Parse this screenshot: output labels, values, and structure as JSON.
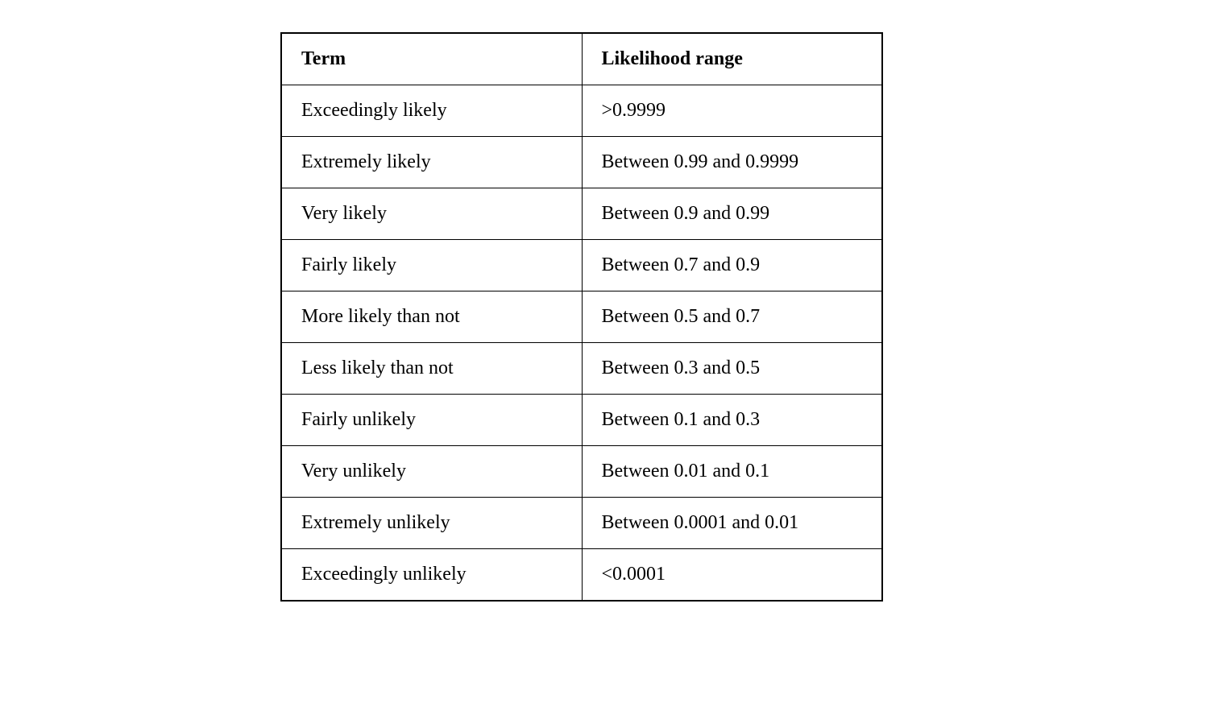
{
  "chart_data": {
    "type": "table",
    "headers": [
      "Term",
      "Likelihood range"
    ],
    "rows": [
      {
        "term": "Exceedingly likely",
        "range": ">0.9999"
      },
      {
        "term": "Extremely likely",
        "range": "Between 0.99 and 0.9999"
      },
      {
        "term": "Very likely",
        "range": "Between 0.9 and 0.99"
      },
      {
        "term": "Fairly likely",
        "range": "Between 0.7 and 0.9"
      },
      {
        "term": "More likely than not",
        "range": "Between 0.5 and 0.7"
      },
      {
        "term": "Less likely than not",
        "range": "Between 0.3 and 0.5"
      },
      {
        "term": "Fairly unlikely",
        "range": "Between 0.1 and 0.3"
      },
      {
        "term": "Very unlikely",
        "range": "Between  0.01 and 0.1"
      },
      {
        "term": "Extremely unlikely",
        "range": "Between 0.0001 and 0.01"
      },
      {
        "term": "Exceedingly unlikely",
        "range": "<0.0001"
      }
    ]
  }
}
